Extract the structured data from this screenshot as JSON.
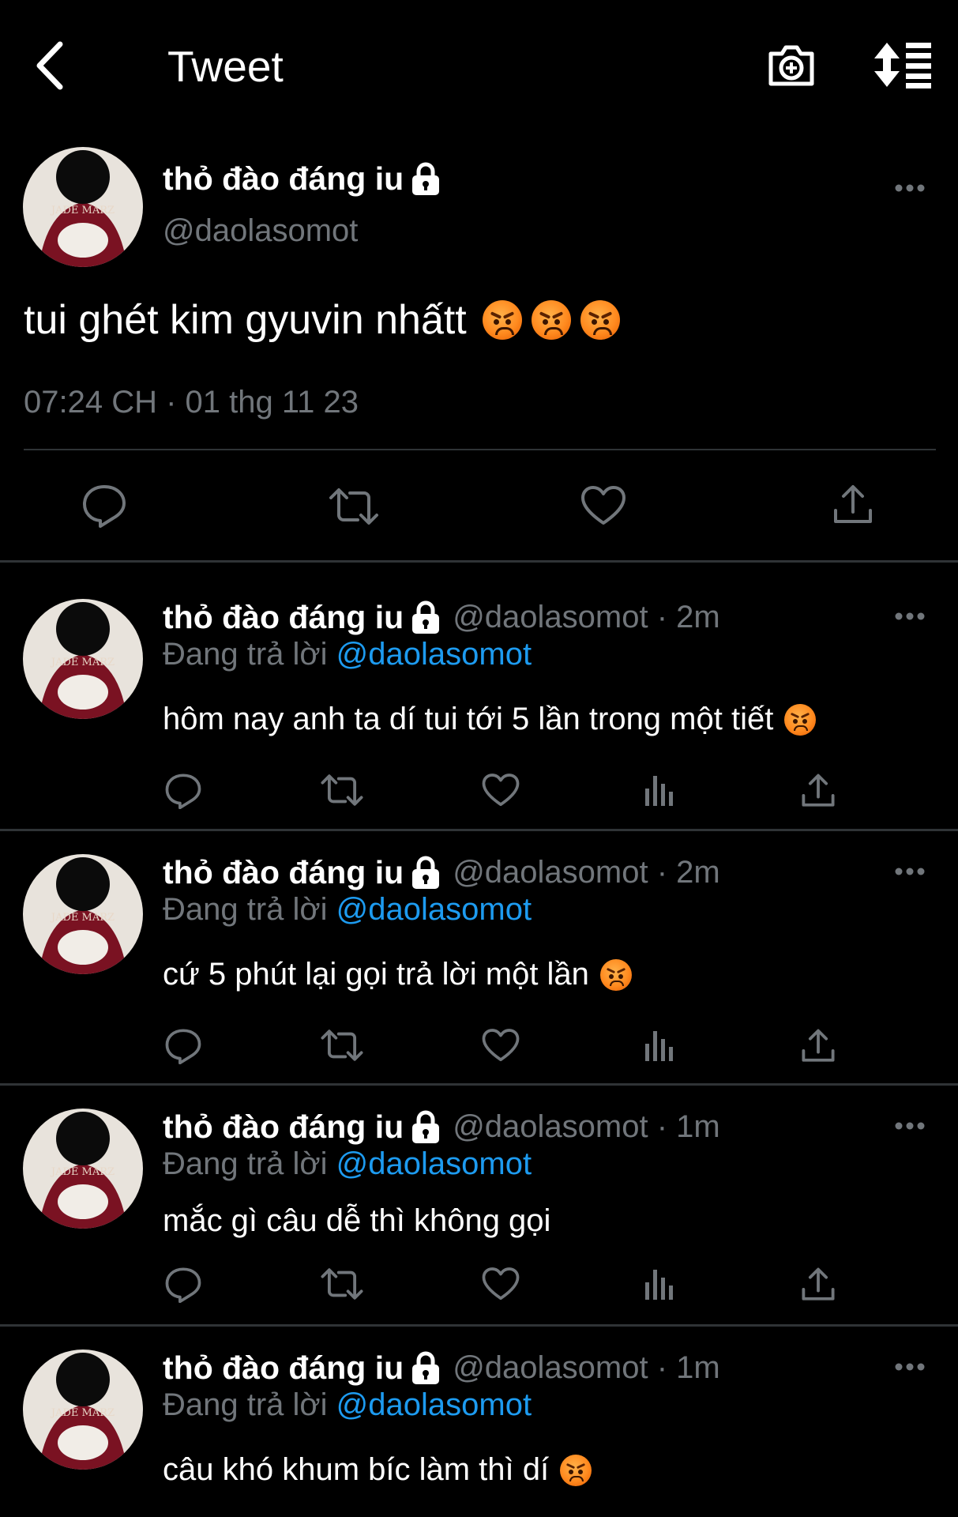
{
  "header": {
    "title": "Tweet",
    "back_icon": "chevron-left-icon",
    "camera_icon": "camera-plus-icon",
    "sort_icon": "sort-arrows-icon"
  },
  "main_tweet": {
    "display_name": "thỏ đào đáng iu",
    "handle": "@daolasomot",
    "text": "tui ghét kim gyuvin nhấtt",
    "emoji_count": 3,
    "timestamp": "07:24 CH · 01 thg 11 23",
    "actions": [
      "reply-icon",
      "retweet-icon",
      "like-icon",
      "share-icon"
    ]
  },
  "replies": [
    {
      "display_name": "thỏ đào đáng iu",
      "meta": "@daolasomot · 2m",
      "replying_prefix": "Đang trả lời",
      "replying_to": "@daolasomot",
      "text": "hôm nay anh ta dí tui tới 5 lần trong một tiết",
      "emoji": true
    },
    {
      "display_name": "thỏ đào đáng iu",
      "meta": "@daolasomot · 2m",
      "replying_prefix": "Đang trả lời",
      "replying_to": "@daolasomot",
      "text": "cứ 5 phút lại gọi trả lời một lần",
      "emoji": true
    },
    {
      "display_name": "thỏ đào đáng iu",
      "meta": "@daolasomot · 1m",
      "replying_prefix": "Đang trả lời",
      "replying_to": "@daolasomot",
      "text": "mắc gì câu dễ thì không gọi",
      "emoji": false
    },
    {
      "display_name": "thỏ đào đáng iu",
      "meta": "@daolasomot · 1m",
      "replying_prefix": "Đang trả lời",
      "replying_to": "@daolasomot",
      "text": "câu khó khum bíc làm thì dí",
      "emoji": true
    }
  ],
  "colors": {
    "background": "#000000",
    "text": "#ffffff",
    "secondary": "#71767b",
    "link": "#1d9bf0",
    "divider": "#2f3336"
  }
}
